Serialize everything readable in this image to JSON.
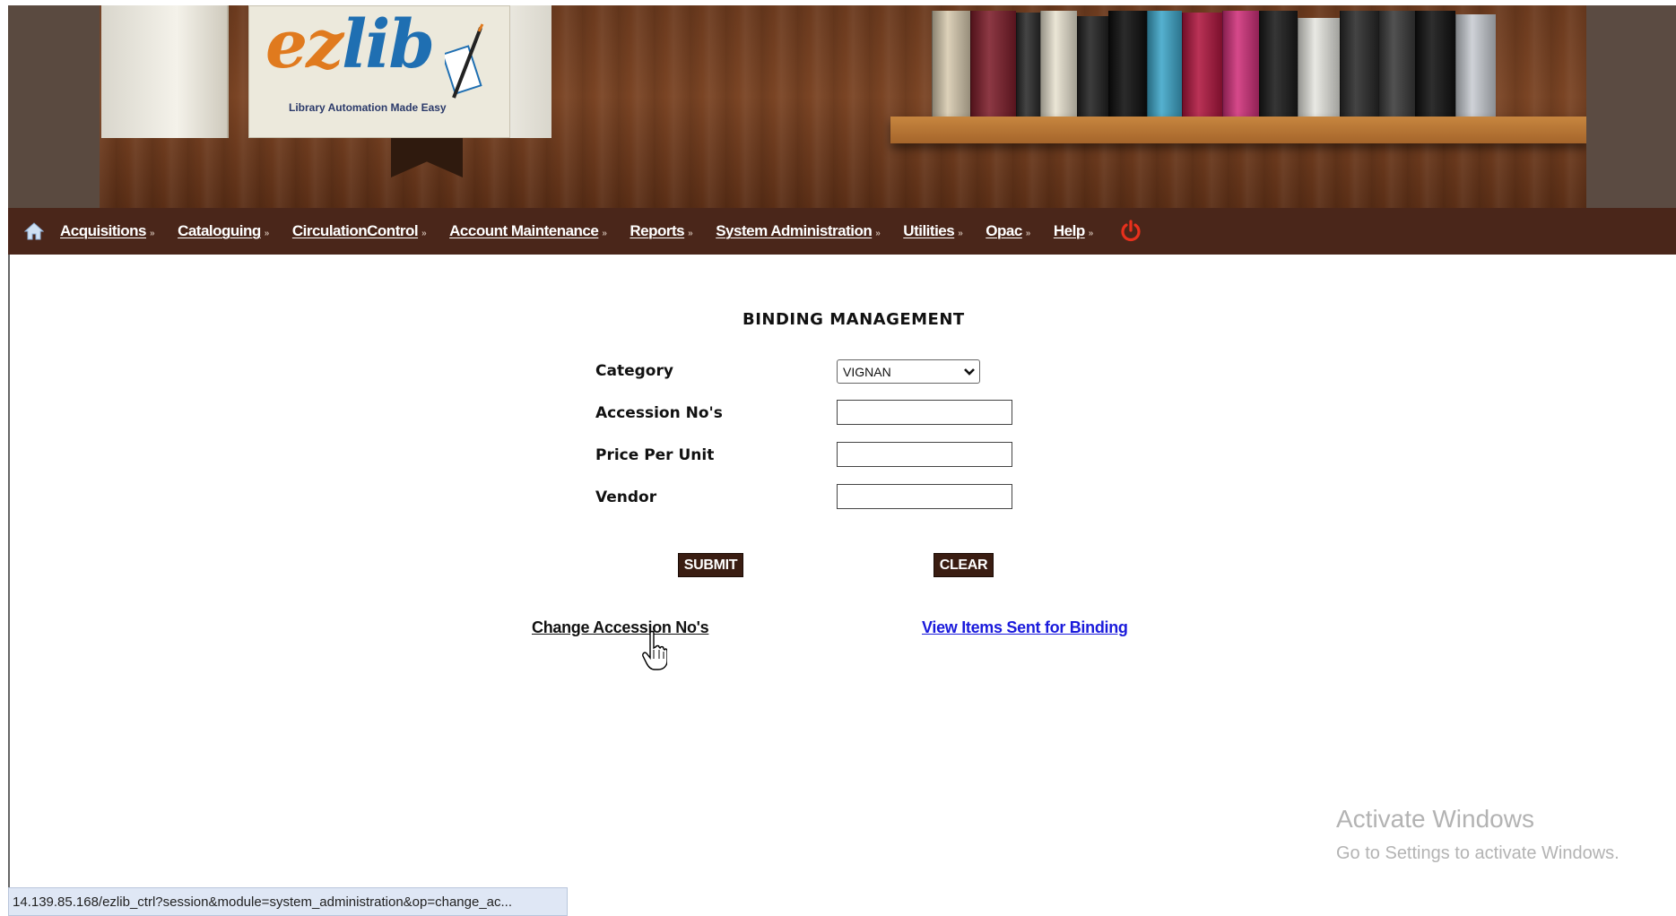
{
  "header": {
    "logo": {
      "ez": "ez",
      "lib": "lib",
      "tagline": "Library Automation Made Easy"
    },
    "book_colors": [
      "#d8cbb0",
      "#7d1d2a",
      "#2b2b2b",
      "#e8e2d0",
      "#222",
      "#0e0e0e",
      "#3ea6c9",
      "#b0163f",
      "#d0307a",
      "#1a1a1a",
      "#e6e6e0",
      "#2a2a2a",
      "#3a3a3a",
      "#111",
      "#c8ccd2"
    ]
  },
  "nav": {
    "home_icon": "home-icon",
    "items": [
      {
        "label": "Acquisitions"
      },
      {
        "label": "Cataloguing"
      },
      {
        "label": "CirculationControl"
      },
      {
        "label": "Account Maintenance"
      },
      {
        "label": "Reports"
      },
      {
        "label": "System Administration"
      },
      {
        "label": "Utilities"
      },
      {
        "label": "Opac"
      },
      {
        "label": "Help"
      }
    ],
    "chevron": "»",
    "power_icon": "power-icon"
  },
  "main": {
    "title": "BINDING MANAGEMENT",
    "form": {
      "category_label": "Category",
      "category_value": "VIGNAN",
      "accession_label": "Accession No's",
      "accession_value": "",
      "price_label": "Price Per Unit",
      "price_value": "",
      "vendor_label": "Vendor",
      "vendor_value": ""
    },
    "buttons": {
      "submit": "SUBMIT",
      "clear": "CLEAR"
    },
    "links": {
      "change_accession": "Change Accession No's",
      "view_items": "View Items Sent for Binding"
    }
  },
  "watermark": {
    "title": "Activate Windows",
    "subtitle": "Go to Settings to activate Windows."
  },
  "status_bar": {
    "url": "14.139.85.168/ezlib_ctrl?session&module=system_administration&op=change_ac..."
  },
  "colors": {
    "nav_bg": "#4a261a",
    "button_bg": "#3a1d12",
    "link_blue": "#1a1adb",
    "power_red": "#e8301c"
  }
}
